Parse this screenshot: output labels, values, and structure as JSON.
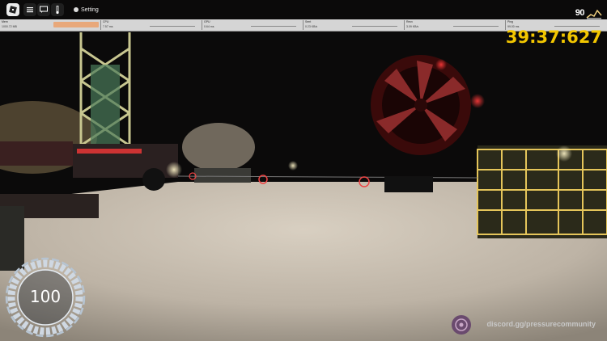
{
  "topbar": {
    "setting_label": "Setting",
    "fps_value": "90"
  },
  "stats": [
    {
      "label": "Mem",
      "value": "1000.72 MB"
    },
    {
      "label": "CPU",
      "value": "7.57 ms"
    },
    {
      "label": "GPU",
      "value": "0.64 ms"
    },
    {
      "label": "Sent",
      "value": "0.23 KB/s"
    },
    {
      "label": "Recv",
      "value": "3.09 KB/s"
    },
    {
      "label": "Ping",
      "value": "99.00 ms"
    }
  ],
  "timer": "39:37:627",
  "health": {
    "value": "100",
    "fraction": 1.0
  },
  "discord": "discord.gg/pressurecommunity",
  "colors": {
    "timer": "#f2c600",
    "accent_orange": "#e8a87a",
    "stat_bar": "#d5d5d5"
  }
}
